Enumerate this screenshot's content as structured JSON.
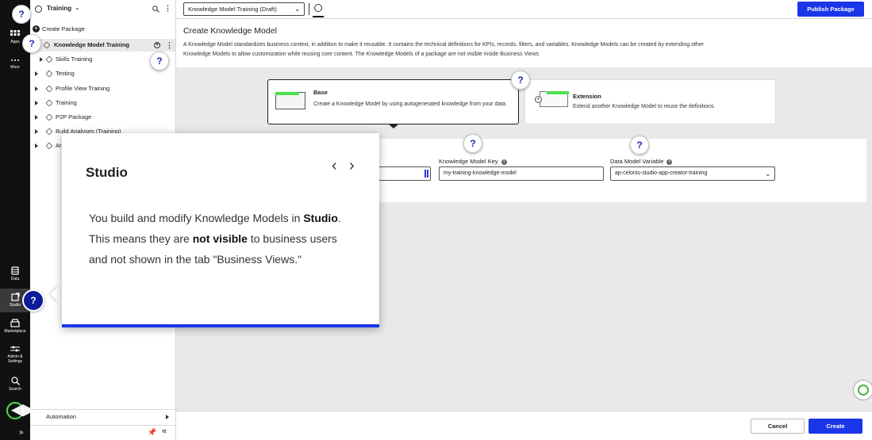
{
  "rail": {
    "items": [
      {
        "label": "Apps",
        "icon": "apps-grid-icon"
      },
      {
        "label": "More",
        "icon": "more-dots-icon"
      },
      {
        "label": "Data",
        "icon": "data-icon"
      },
      {
        "label": "Studio",
        "icon": "studio-icon"
      },
      {
        "label": "Marketplace",
        "icon": "marketplace-icon"
      },
      {
        "label": "Admin & Settings",
        "icon": "sliders-icon"
      },
      {
        "label": "Search",
        "icon": "search-icon"
      }
    ],
    "expand_label": "»"
  },
  "sidebar": {
    "space_title": "Training",
    "create_package": "Create Package",
    "tree": [
      {
        "label": "Knowledge Model Training",
        "selected": true
      },
      {
        "label": "Skills Training"
      },
      {
        "label": "Testing"
      },
      {
        "label": "Profile View Training"
      },
      {
        "label": "Training"
      },
      {
        "label": "P2P Package"
      },
      {
        "label": "Build Analyses (Training)"
      },
      {
        "label": "Ar"
      }
    ],
    "automation_label": "Automation",
    "collapse_label": "«"
  },
  "header": {
    "package_select": "Knowledge Model Training (Draft)",
    "publish_label": "Publish Package"
  },
  "main": {
    "title": "Create Knowledge Model",
    "description": "A Knowledge Model standardizes business context, in addition to make it reusable. It contains the technical definitions for KPIs, records, filters, and variables. Knowledge Models can be created by extending other Knowledge Models to allow customization while reusing core content. The Knowledge Models of a package are not visible inside Business Views",
    "options": [
      {
        "title": "Base",
        "desc": "Create a Knowledge Model by using autogenerated knowledge from your data."
      },
      {
        "title": "Extension",
        "desc": "Extend another Knowledge Model to reuse the definitions."
      }
    ],
    "form": {
      "key_label": "Knowledge Model Key",
      "key_value": "my-training-knowledge-model",
      "variable_label": "Data Model Variable",
      "variable_value": "ap-celonis-studio-app-creator-training"
    },
    "cancel_label": "Cancel",
    "create_label": "Create"
  },
  "popover": {
    "title": "Studio",
    "body_1": "You build and modify Knowledge Models in ",
    "body_bold_1": "Studio",
    "body_2": ". This means they are ",
    "body_bold_2": "not visible",
    "body_3": " to business users and not shown in the tab \"Business Views.\"",
    "prev_label": "‹",
    "next_label": "›"
  },
  "help_marker": "?",
  "colors": {
    "accent": "#1b35e8",
    "rail": "#111111",
    "help_dark": "#0c1c9a",
    "base_green": "#4ce04c"
  }
}
